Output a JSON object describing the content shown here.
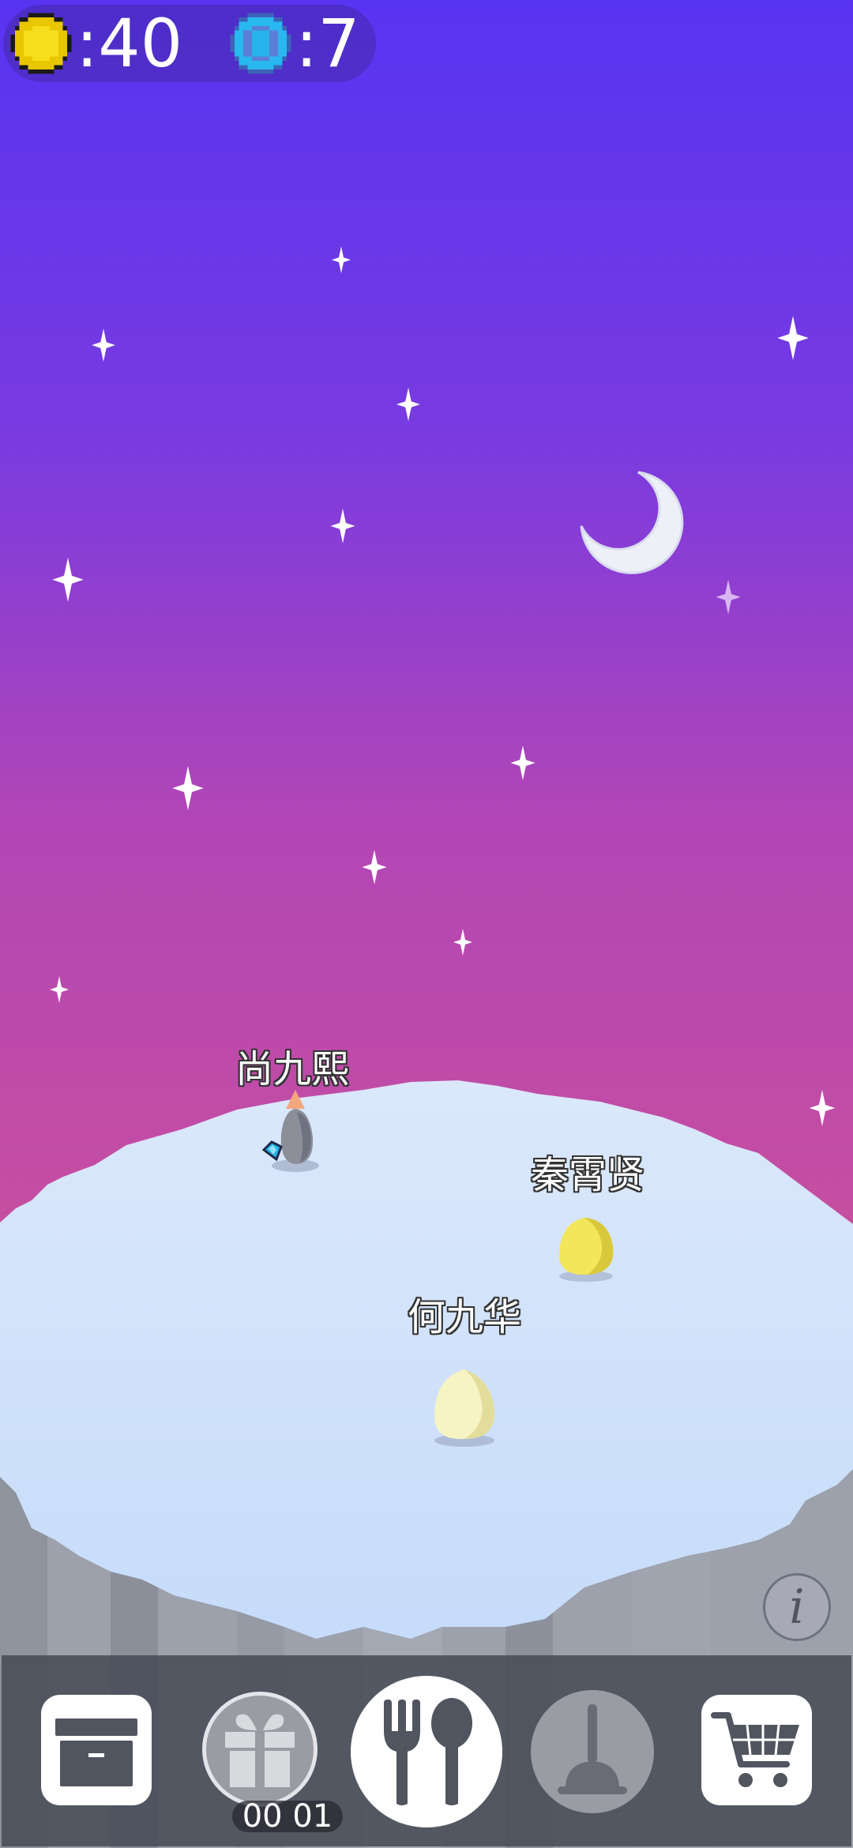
{
  "hud": {
    "coins": ":40",
    "gems": ":7",
    "coin_icon": "gold-coin-icon",
    "gem_icon": "blue-gem-icon"
  },
  "pets": [
    {
      "name": "尚九熙",
      "kind": "grey-egg-pet"
    },
    {
      "name": "秦霄贤",
      "kind": "yellow-egg-pet"
    },
    {
      "name": "何九华",
      "kind": "cream-egg-pet"
    }
  ],
  "toolbar": {
    "storage_icon": "storage-box-icon",
    "gift_icon": "gift-icon",
    "gift_timer": "00 01",
    "feed_icon": "fork-spoon-icon",
    "clean_icon": "plunger-icon",
    "shop_icon": "shopping-cart-icon"
  },
  "info_button": {
    "icon": "info-icon",
    "label": "i"
  },
  "colors": {
    "sky_top": "#5a36f0",
    "sky_mid": "#8f3fd0",
    "sky_bottom": "#c84ea0",
    "ground": "#cfe2fb",
    "cliff": "#9fa3ae"
  }
}
